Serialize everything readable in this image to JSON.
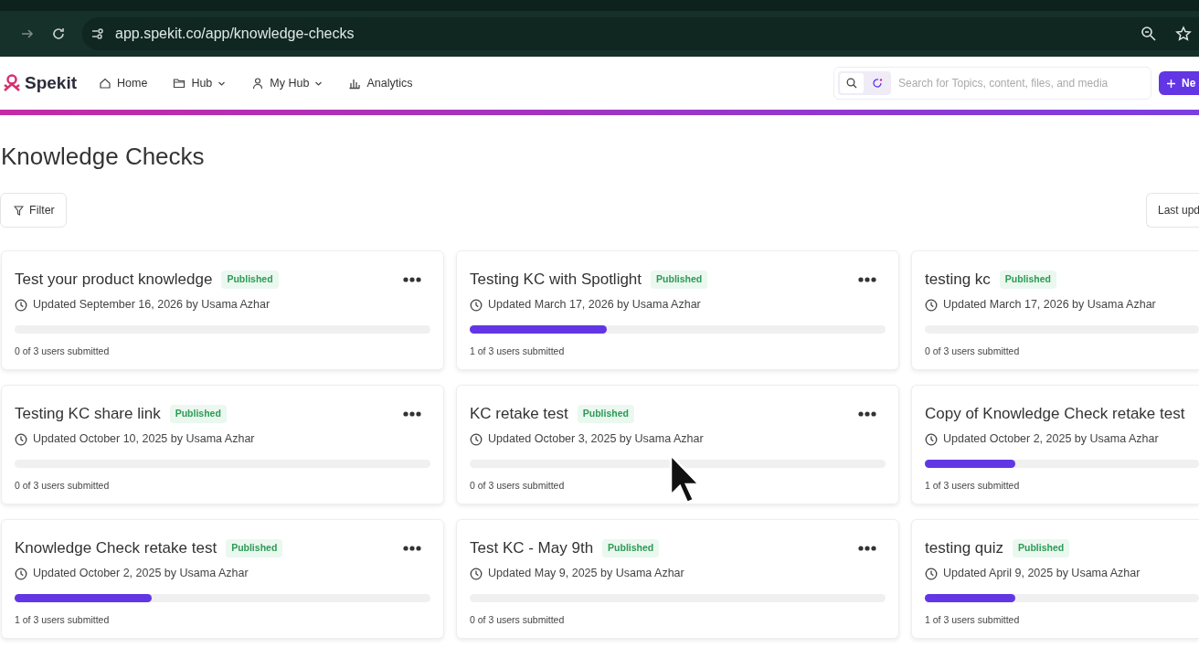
{
  "browser": {
    "url": "app.spekit.co/app/knowledge-checks"
  },
  "nav": {
    "brand": "Spekit",
    "items": [
      {
        "label": "Home",
        "dropdown": false
      },
      {
        "label": "Hub",
        "dropdown": true
      },
      {
        "label": "My Hub",
        "dropdown": true
      },
      {
        "label": "Analytics",
        "dropdown": false
      }
    ],
    "search": {
      "placeholder": "Search for Topics, content, files, and media"
    },
    "new_button": "Ne"
  },
  "page": {
    "title": "Knowledge Checks",
    "filter_button": "Filter",
    "sort_button": "Last upd"
  },
  "cards": [
    {
      "title": "Test your product knowledge",
      "status": "Published",
      "updated": "Updated September 16, 2026 by Usama Azhar",
      "level": 0,
      "submitted": "0 of 3 users submitted",
      "menu": true
    },
    {
      "title": "Testing KC with Spotlight",
      "status": "Published",
      "updated": "Updated March 17, 2026 by Usama Azhar",
      "level": 0.33,
      "submitted": "1 of 3 users submitted",
      "menu": true
    },
    {
      "title": "testing kc",
      "status": "Published",
      "updated": "Updated March 17, 2026 by Usama Azhar",
      "level": 0,
      "submitted": "0 of 3 users submitted",
      "menu": false
    },
    {
      "title": "Testing KC share link",
      "status": "Published",
      "updated": "Updated October 10, 2025 by Usama Azhar",
      "level": 0,
      "submitted": "0 of 3 users submitted",
      "menu": true
    },
    {
      "title": "KC retake test",
      "status": "Published",
      "updated": "Updated October 3, 2025 by Usama Azhar",
      "level": 0,
      "submitted": "0 of 3 users submitted",
      "menu": true
    },
    {
      "title": "Copy of Knowledge Check retake test",
      "updated": "Updated October 2, 2025 by Usama Azhar",
      "level": 0.33,
      "submitted": "1 of 3 users submitted",
      "menu": false
    },
    {
      "title": "Knowledge Check retake test",
      "status": "Published",
      "updated": "Updated October 2, 2025 by Usama Azhar",
      "level": 0.33,
      "submitted": "1 of 3 users submitted",
      "menu": true
    },
    {
      "title": "Test KC - May 9th",
      "status": "Published",
      "updated": "Updated May 9, 2025 by Usama Azhar",
      "level": 0,
      "submitted": "0 of 3 users submitted",
      "menu": true
    },
    {
      "title": "testing quiz",
      "status": "Published",
      "updated": "Updated April 9, 2025 by Usama Azhar",
      "level": 0.33,
      "submitted": "1 of 3 users submitted",
      "menu": false
    }
  ]
}
